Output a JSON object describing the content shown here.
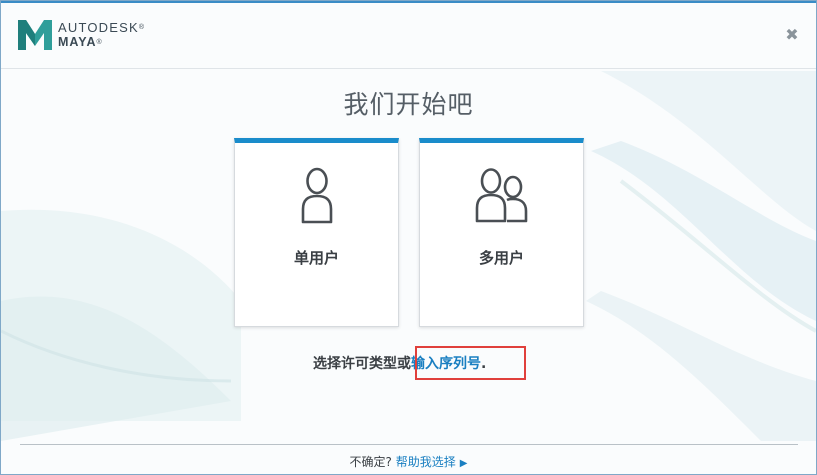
{
  "header": {
    "brand": "AUTODESK",
    "product": "MAYA",
    "close_icon": "close-icon"
  },
  "main": {
    "title": "我们开始吧",
    "cards": [
      {
        "label": "单用户",
        "icon": "single-user-icon"
      },
      {
        "label": "多用户",
        "icon": "multi-user-icon"
      }
    ],
    "prompt_text": "选择许可类型或",
    "serial_link": "输入序列号",
    "prompt_suffix": "."
  },
  "footer": {
    "question": "不确定?",
    "help_link": "帮助我选择",
    "arrow_icon": "play-arrow-icon"
  },
  "colors": {
    "accent": "#1a8ccb",
    "link": "#1a7fc1",
    "highlight": "#e0403c"
  }
}
